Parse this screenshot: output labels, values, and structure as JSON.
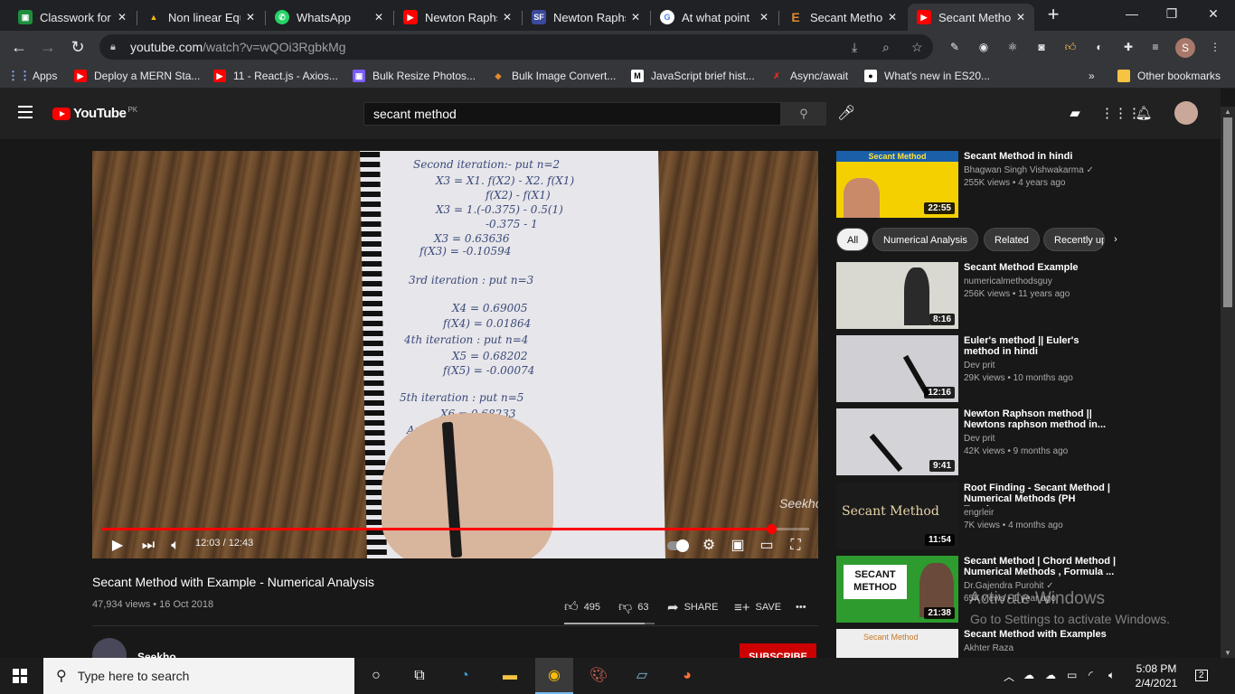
{
  "browser": {
    "tabs": [
      {
        "title": "Classwork for (",
        "icon": "classroom-icon",
        "color": "#1e8e3e"
      },
      {
        "title": "Non linear Equ",
        "icon": "drive-icon",
        "color": "#fbbc04"
      },
      {
        "title": "WhatsApp",
        "icon": "whatsapp-icon",
        "color": "#25d366"
      },
      {
        "title": "Newton Raphs",
        "icon": "youtube-icon",
        "color": "#ff0000"
      },
      {
        "title": "Newton Raphs",
        "icon": "sf-icon",
        "color": "#3b4a9c"
      },
      {
        "title": "At what point",
        "icon": "google-icon",
        "color": "#4285f4"
      },
      {
        "title": "Secant Metho",
        "icon": "e-icon",
        "color": "#c77a2b"
      },
      {
        "title": "Secant Metho",
        "icon": "youtube-icon",
        "color": "#ff0000"
      }
    ],
    "url_host": "youtube.com",
    "url_path": "/watch?v=wQOi3RgbkMg",
    "profile_initial": "S",
    "bookmarks": [
      {
        "label": "Apps",
        "icon": "apps-grid-icon",
        "color": "#4285f4"
      },
      {
        "label": "Deploy a MERN Sta...",
        "icon": "youtube-icon",
        "color": "#ff0000"
      },
      {
        "label": "11 - React.js - Axios...",
        "icon": "youtube-icon",
        "color": "#ff0000"
      },
      {
        "label": "Bulk Resize Photos...",
        "icon": "bulk-resize-icon",
        "color": "#7a5cff"
      },
      {
        "label": "Bulk Image Convert...",
        "icon": "diamond-icon",
        "color": "#e08a2c"
      },
      {
        "label": "JavaScript brief hist...",
        "icon": "medium-icon",
        "color": "#000000"
      },
      {
        "label": "Async/await",
        "icon": "runner-icon",
        "color": "#d93025"
      },
      {
        "label": "What's new in ES20...",
        "icon": "medium-dots-icon",
        "color": "#000000"
      }
    ],
    "bookmarks_more": "»",
    "other_bookmarks": "Other bookmarks"
  },
  "youtube": {
    "logo_text": "YouTube",
    "country": "PK",
    "search_query": "secant method",
    "video": {
      "title": "Secant Method with Example - Numerical Analysis",
      "views_date": "47,934 views • 16 Oct 2018",
      "time": "12:03 / 12:43",
      "progress": 0.946,
      "likes": "495",
      "dislikes": "63",
      "share": "SHARE",
      "save": "SAVE",
      "watermark": "Seekho",
      "like_ratio": 0.887
    },
    "notes": [
      "Second iteration:- put n=2",
      "X3 = X1. f(X2) - X2. f(X1)",
      "f(X2) - f(X1)",
      "X3 = 1.(-0.375) - 0.5(1)",
      "-0.375 - 1",
      "X3 = 0.63636",
      "f(X3) = -0.10594",
      "3rd iteration : put n=3",
      "X4 = 0.69005",
      "f(X4) = 0.01864",
      "4th iteration : put n=4",
      "X5 = 0.68202",
      "f(X5) = -0.00074",
      "5th iteration : put n=5",
      "X6 = 0.68233",
      "Approxim"
    ],
    "channel": {
      "name": "Seekho",
      "subscribe": "SUBSCRIBE"
    },
    "chips": [
      "All",
      "Numerical Analysis",
      "Related",
      "Recently up"
    ],
    "recommended": [
      {
        "title": "Secant Method in hindi",
        "channel": "Bhagwan Singh Vishwakarma ✓",
        "meta": "255K views • 4 years ago",
        "duration": "22:55",
        "thumb_color": "#f5d000",
        "thumb_text": "Secant Method"
      },
      {
        "title": "Secant Method Example",
        "channel": "numericalmethodsguy",
        "meta": "256K views • 11 years ago",
        "duration": "8:16",
        "thumb_color": "#d9d9d2",
        "thumb_text": ""
      },
      {
        "title": "Euler's method || Euler's method in hindi",
        "channel": "Dev prit",
        "meta": "29K views • 10 months ago",
        "duration": "12:16",
        "thumb_color": "#cfcfd4",
        "thumb_text": ""
      },
      {
        "title": "Newton Raphson method || Newtons raphson method in...",
        "channel": "Dev prit",
        "meta": "42K views • 9 months ago",
        "duration": "9:41",
        "thumb_color": "#d4d4d8",
        "thumb_text": ""
      },
      {
        "title": "Root Finding - Secant Method | Numerical Methods (PH Tagalo...",
        "channel": "engrleir",
        "meta": "7K views • 4 months ago",
        "duration": "11:54",
        "thumb_color": "#1b1b1b",
        "thumb_text": "Secant Method"
      },
      {
        "title": "Secant Method | Chord Method | Numerical Methods , Formula ...",
        "channel": "Dr.Gajendra Purohit ✓",
        "meta": "65K views • 1 year ago",
        "duration": "21:38",
        "thumb_color": "#2e9b2e",
        "thumb_text": "SECANT METHOD"
      },
      {
        "title": "Secant Method with Examples",
        "channel": "Akhter Raza",
        "meta": "",
        "duration": "",
        "thumb_color": "#eeeeee",
        "thumb_text": "Secant Method"
      }
    ]
  },
  "windows": {
    "activate_title": "Activate Windows",
    "activate_sub": "Go to Settings to activate Windows.",
    "search_placeholder": "Type here to search",
    "time": "5:08 PM",
    "date": "2/4/2021",
    "notifications": "2"
  }
}
